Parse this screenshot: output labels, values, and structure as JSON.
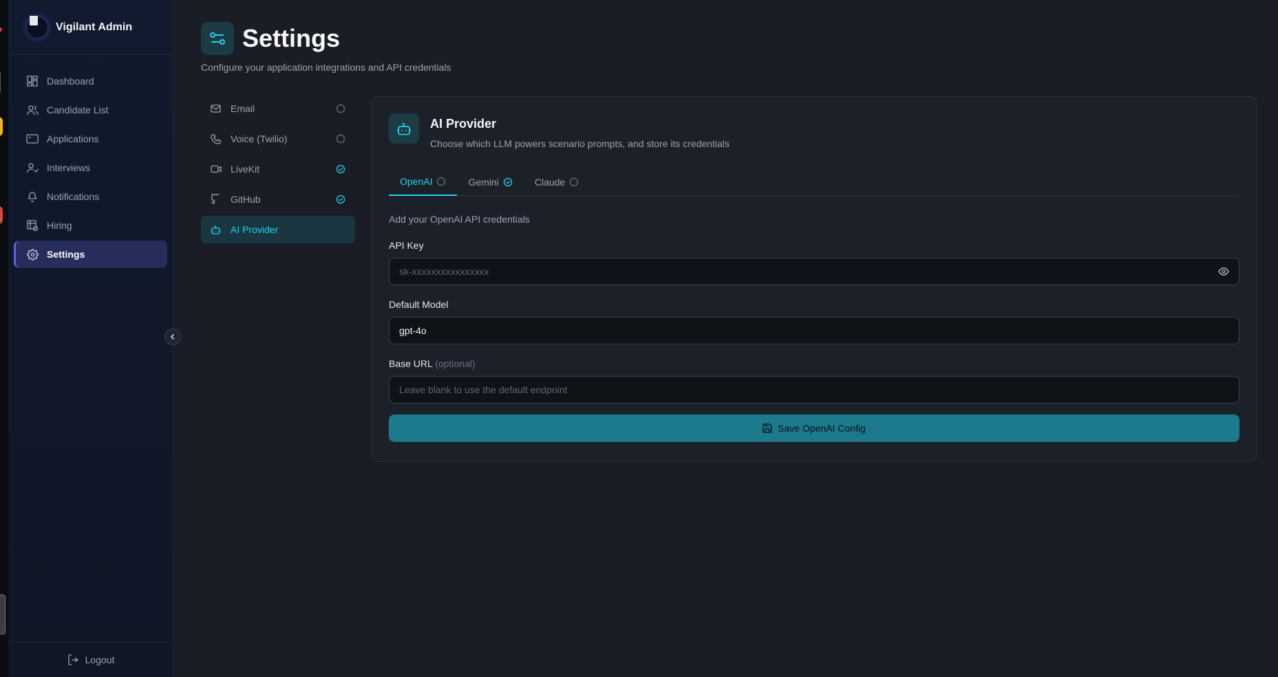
{
  "brand": {
    "name": "Vigilant Admin"
  },
  "sidebar": {
    "items": [
      {
        "label": "Dashboard",
        "icon": "dashboard-icon"
      },
      {
        "label": "Candidate List",
        "icon": "users-icon"
      },
      {
        "label": "Applications",
        "icon": "applications-icon"
      },
      {
        "label": "Interviews",
        "icon": "user-check-icon"
      },
      {
        "label": "Notifications",
        "icon": "bell-icon"
      },
      {
        "label": "Hiring",
        "icon": "hiring-icon"
      },
      {
        "label": "Settings",
        "icon": "gear-icon",
        "active": true
      }
    ],
    "logout_label": "Logout"
  },
  "page": {
    "title": "Settings",
    "subtitle": "Configure your application integrations and API credentials"
  },
  "subnav": {
    "items": [
      {
        "label": "Email",
        "icon": "mail-icon",
        "status": "unconfigured"
      },
      {
        "label": "Voice (Twilio)",
        "icon": "phone-icon",
        "status": "unconfigured"
      },
      {
        "label": "LiveKit",
        "icon": "video-icon",
        "status": "configured"
      },
      {
        "label": "GitHub",
        "icon": "github-icon",
        "status": "configured"
      },
      {
        "label": "AI Provider",
        "icon": "bot-icon",
        "status": "none",
        "active": true
      }
    ]
  },
  "card": {
    "title": "AI Provider",
    "description": "Choose which LLM powers scenario prompts, and store its credentials",
    "tabs": [
      {
        "label": "OpenAI",
        "status": "unconfigured",
        "active": true
      },
      {
        "label": "Gemini",
        "status": "configured"
      },
      {
        "label": "Claude",
        "status": "unconfigured"
      }
    ],
    "note": "Add your OpenAI API credentials",
    "api_key": {
      "label": "API Key",
      "placeholder": "sk-xxxxxxxxxxxxxxxx"
    },
    "default_model": {
      "label": "Default Model",
      "value": "gpt-4o"
    },
    "base_url": {
      "label": "Base URL",
      "optional": "(optional)",
      "placeholder": "Leave blank to use the default endpoint"
    },
    "save_label": "Save OpenAI Config"
  },
  "colors": {
    "accent": "#22d3ee",
    "active_nav": "#262d5a",
    "button": "#1c7a8c"
  }
}
